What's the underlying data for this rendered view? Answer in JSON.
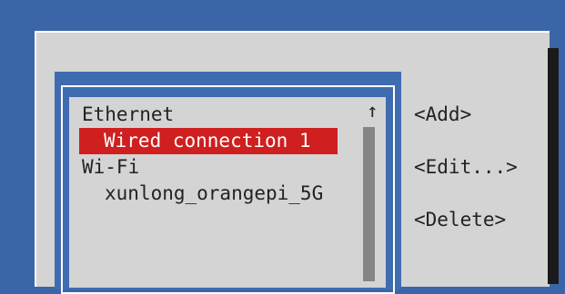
{
  "connection_list": {
    "groups": [
      {
        "label": "Ethernet",
        "items": [
          "Wired connection 1"
        ]
      },
      {
        "label": "Wi-Fi",
        "items": [
          "xunlong_orangepi_5G"
        ]
      }
    ],
    "selected_item": "Wired connection 1",
    "scroll_up_glyph": "↑"
  },
  "buttons": {
    "add": "<Add>",
    "edit": "<Edit...>",
    "delete": "<Delete>"
  },
  "colors": {
    "background_blue": "#3a66a8",
    "panel_gray": "#d4d4d4",
    "selection_red": "#cf1f1f"
  }
}
